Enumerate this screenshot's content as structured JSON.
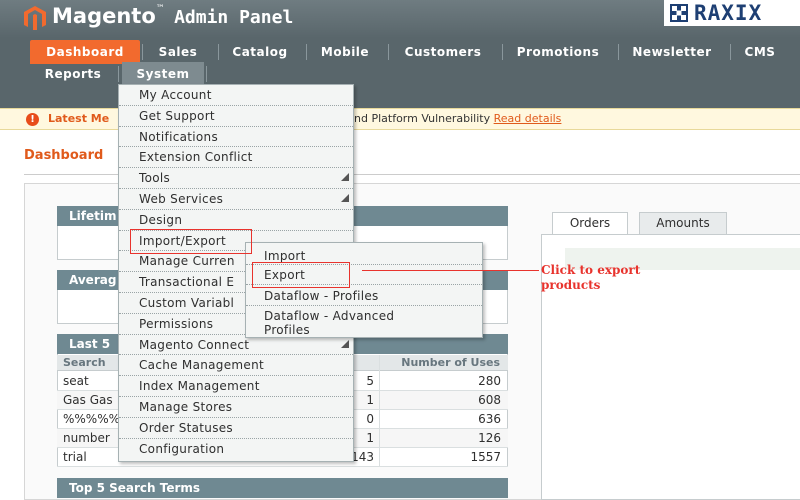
{
  "header": {
    "brand": "Magento",
    "brand_tm": "™",
    "brand_sub": "Admin Panel",
    "partner_logo": "RAXIX"
  },
  "nav": {
    "row1": [
      "Dashboard",
      "Sales",
      "Catalog",
      "Mobile",
      "Customers",
      "Promotions",
      "Newsletter",
      "CMS"
    ],
    "row2": [
      "Reports",
      "System"
    ],
    "active": "Dashboard"
  },
  "notice": {
    "lead": "Latest Me",
    "tail": "nd Platform Vulnerability",
    "link": "Read details"
  },
  "page": {
    "title": "Dashboard"
  },
  "left_panel": {
    "lifetime": "Lifetim",
    "average": "Averag",
    "last5": "Last 5",
    "grid_headers": [
      "Search",
      "Number of Uses"
    ],
    "rows": [
      {
        "term": "seat",
        "results": "5",
        "uses": "280"
      },
      {
        "term": "Gas Gas",
        "results": "1",
        "uses": "608"
      },
      {
        "term": "%%%%%",
        "results": "0",
        "uses": "636"
      },
      {
        "term": "number",
        "results": "1",
        "uses": "126"
      },
      {
        "term": "trial",
        "results": "143",
        "uses": "1557"
      }
    ],
    "top5": "Top 5 Search Terms"
  },
  "right_panel": {
    "tabs": [
      "Orders",
      "Amounts"
    ]
  },
  "system_menu": {
    "items": [
      {
        "label": "My Account",
        "arrow": false
      },
      {
        "label": "Get Support",
        "arrow": false
      },
      {
        "label": "Notifications",
        "arrow": false
      },
      {
        "label": "Extension Conflict",
        "arrow": false
      },
      {
        "label": "Tools",
        "arrow": true
      },
      {
        "label": "Web Services",
        "arrow": true
      },
      {
        "label": "Design",
        "arrow": false
      },
      {
        "label": "Import/Export",
        "arrow": false
      },
      {
        "label": "Manage Curren",
        "arrow": false
      },
      {
        "label": "Transactional E",
        "arrow": false
      },
      {
        "label": "Custom Variabl",
        "arrow": false
      },
      {
        "label": "Permissions",
        "arrow": false
      },
      {
        "label": "Magento Connect",
        "arrow": true
      },
      {
        "label": "Cache Management",
        "arrow": false
      },
      {
        "label": "Index Management",
        "arrow": false
      },
      {
        "label": "Manage Stores",
        "arrow": false
      },
      {
        "label": "Order Statuses",
        "arrow": false
      },
      {
        "label": "Configuration",
        "arrow": false
      }
    ]
  },
  "import_export_menu": {
    "items": [
      "Import",
      "Export",
      "Dataflow - Profiles",
      "Dataflow - Advanced Profiles"
    ]
  },
  "annotation": {
    "line1": "Click to export",
    "line2": "products"
  },
  "colors": {
    "nav_active": "#f26a2e",
    "box_header": "#6f8992",
    "annotation_red": "#e8332d"
  }
}
